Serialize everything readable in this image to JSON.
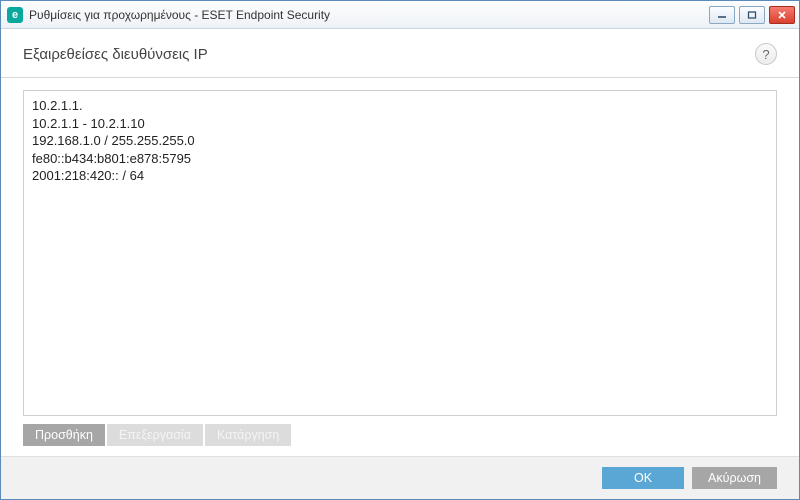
{
  "titlebar": {
    "app_icon_letter": "e",
    "title": "Ρυθμίσεις για προχωρημένους - ESET Endpoint Security"
  },
  "header": {
    "title": "Εξαιρεθείσες διευθύνσεις IP",
    "help_label": "?"
  },
  "ip_list": [
    "10.2.1.1.",
    "10.2.1.1 - 10.2.1.10",
    "192.168.1.0 / 255.255.255.0",
    "fe80::b434:b801:e878:5795",
    "2001:218:420:: / 64"
  ],
  "actions": {
    "add": "Προσθήκη",
    "edit": "Επεξεργασία",
    "remove": "Κατάργηση"
  },
  "footer": {
    "ok": "OK",
    "cancel": "Ακύρωση"
  }
}
